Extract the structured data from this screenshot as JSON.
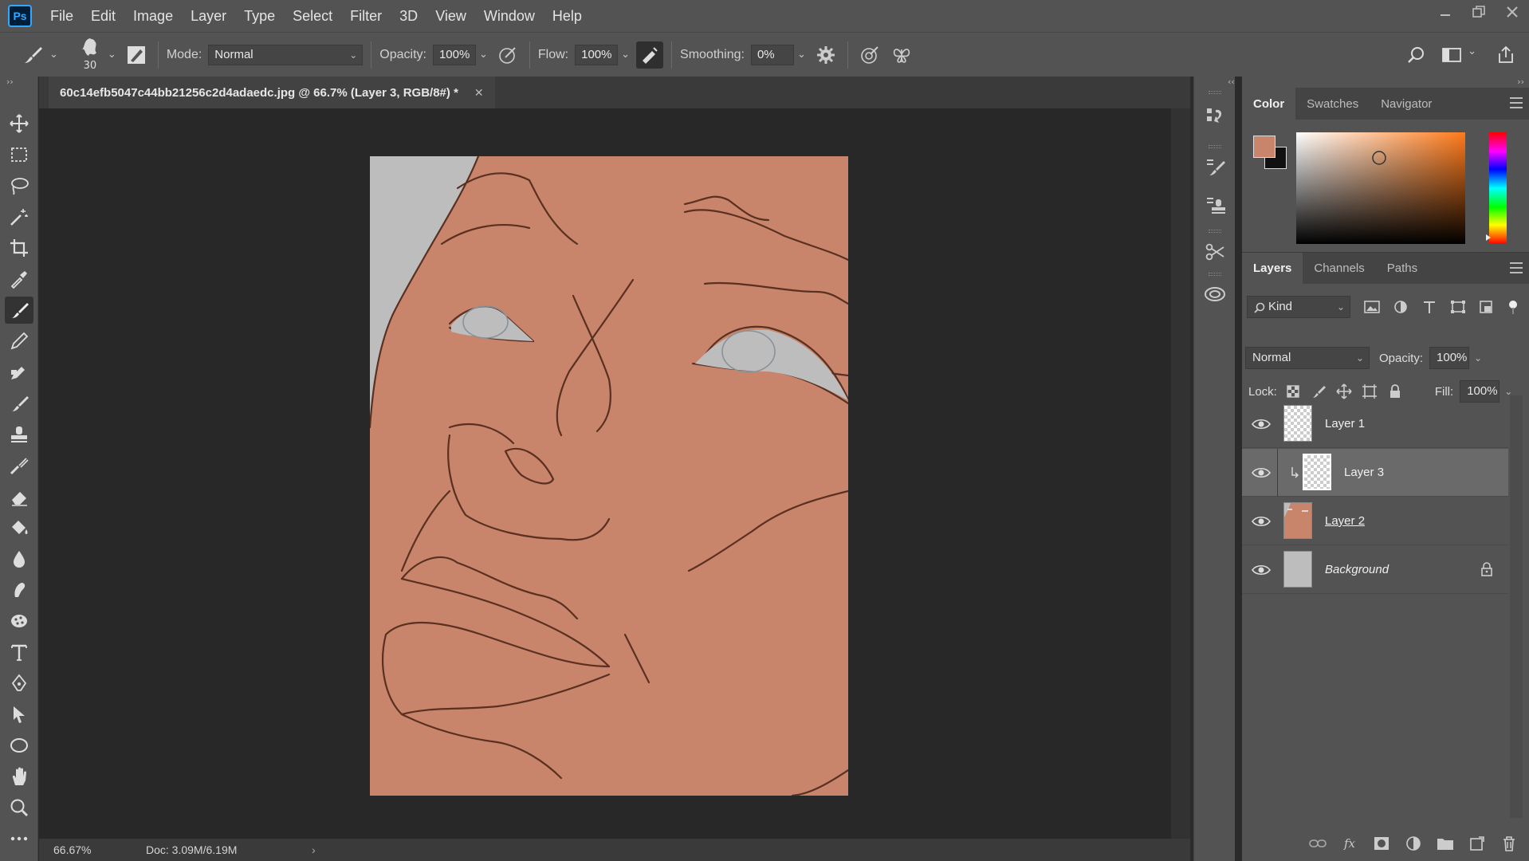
{
  "app": {
    "logo": "Ps"
  },
  "menu": [
    "File",
    "Edit",
    "Image",
    "Layer",
    "Type",
    "Select",
    "Filter",
    "3D",
    "View",
    "Window",
    "Help"
  ],
  "window_controls": [
    "minimize-icon",
    "restore-icon",
    "close-icon"
  ],
  "options": {
    "brush_size": "30",
    "mode_label": "Mode:",
    "mode_value": "Normal",
    "opacity_label": "Opacity:",
    "opacity_value": "100%",
    "flow_label": "Flow:",
    "flow_value": "100%",
    "smoothing_label": "Smoothing:",
    "smoothing_value": "0%"
  },
  "document": {
    "tab_title": "60c14efb5047c44bb21256c2d4adaedc.jpg @ 66.7% (Layer 3, RGB/8#) *",
    "zoom": "66.67%",
    "doc_info": "Doc: 3.09M/6.19M",
    "skin_color": "#c8856b",
    "bg_color": "#bdbdbd",
    "line_color": "#5a3020"
  },
  "color_panel": {
    "tabs": [
      "Color",
      "Swatches",
      "Navigator"
    ],
    "foreground": "#c8856b",
    "background": "#111111",
    "hue_color": "#ff7a1a"
  },
  "layers_panel": {
    "tabs": [
      "Layers",
      "Channels",
      "Paths"
    ],
    "filter_label": "Kind",
    "blend_mode": "Normal",
    "opacity_label": "Opacity:",
    "opacity_value": "100%",
    "lock_label": "Lock:",
    "fill_label": "Fill:",
    "fill_value": "100%",
    "layers": [
      {
        "name": "Layer 1",
        "visible": true,
        "selected": false,
        "clipped": false,
        "locked": false
      },
      {
        "name": "Layer 3",
        "visible": true,
        "selected": true,
        "clipped": true,
        "locked": false
      },
      {
        "name": "Layer 2",
        "visible": true,
        "selected": false,
        "clipped": false,
        "locked": false
      },
      {
        "name": "Background",
        "visible": true,
        "selected": false,
        "clipped": false,
        "locked": true
      }
    ],
    "footer_icons": [
      "link-icon",
      "fx-icon",
      "mask-icon",
      "adjustment-icon",
      "group-folder-icon",
      "new-layer-icon",
      "trash-icon"
    ],
    "footer_fx": "fx"
  }
}
